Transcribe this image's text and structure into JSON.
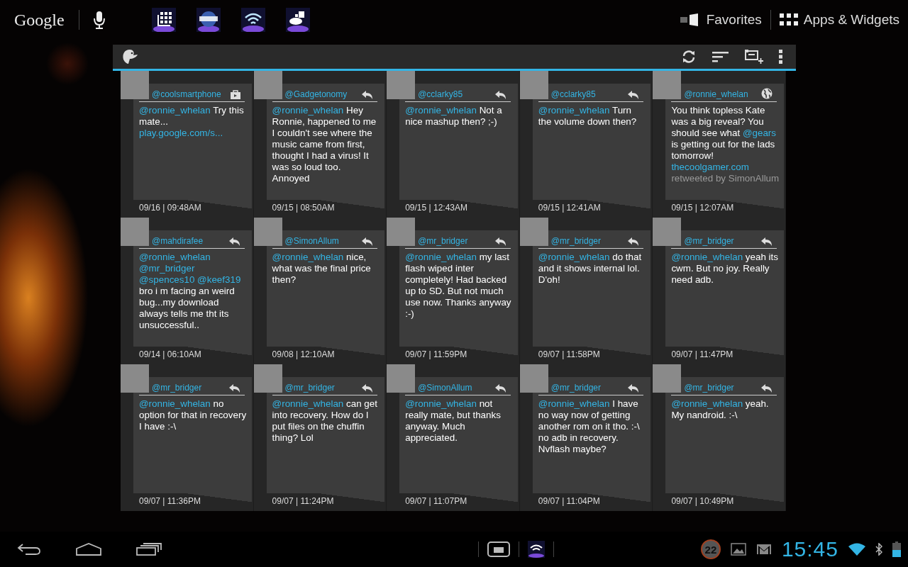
{
  "top_bar": {
    "search_label": "Google",
    "favorites": "Favorites",
    "apps": "Apps & Widgets"
  },
  "tweets": [
    {
      "handle": "@coolsmartphone",
      "kind": "store",
      "parts": [
        {
          "kind": "mention",
          "text": "@ronnie_whelan"
        },
        {
          "kind": "plain",
          "text": "Try this mate..."
        },
        {
          "kind": "link",
          "text": "play.google.com/s..."
        }
      ],
      "time": "09/16 | 09:48AM"
    },
    {
      "handle": "@Gadgetonomy",
      "kind": "reply",
      "parts": [
        {
          "kind": "mention",
          "text": "@ronnie_whelan"
        },
        {
          "kind": "plain",
          "text": "Hey Ronnie, happened to me I couldn't see where the music came from first, thought I had a virus! It was so loud too. Annoyed"
        }
      ],
      "time": "09/15 | 08:50AM"
    },
    {
      "handle": "@cclarky85",
      "kind": "reply",
      "parts": [
        {
          "kind": "mention",
          "text": "@ronnie_whelan"
        },
        {
          "kind": "plain",
          "text": "Not a nice mashup then? ;-)"
        }
      ],
      "time": "09/15 | 12:43AM"
    },
    {
      "handle": "@cclarky85",
      "kind": "reply",
      "parts": [
        {
          "kind": "mention",
          "text": "@ronnie_whelan"
        },
        {
          "kind": "plain",
          "text": "Turn the volume down then?"
        }
      ],
      "time": "09/15 | 12:41AM"
    },
    {
      "handle": "@ronnie_whelan",
      "kind": "globe",
      "parts": [
        {
          "kind": "plain",
          "text": "You think topless Kate was a big reveal? You should see what"
        },
        {
          "kind": "mention",
          "text": "@gears"
        },
        {
          "kind": "plain",
          "text": "is getting out for the lads tomorrow!"
        },
        {
          "kind": "link",
          "text": "thecoolgamer.com"
        },
        {
          "kind": "retweet",
          "text": "retweeted by SimonAllum"
        }
      ],
      "time": "09/15 | 12:07AM"
    },
    {
      "handle": "@mahdirafee",
      "kind": "reply",
      "parts": [
        {
          "kind": "mention",
          "text": "@ronnie_whelan"
        },
        {
          "kind": "mention",
          "text": "@mr_bridger"
        },
        {
          "kind": "mention",
          "text": "@spences10"
        },
        {
          "kind": "mention",
          "text": "@keef319"
        },
        {
          "kind": "plain",
          "text": "bro i m facing an weird bug...my download always tells me tht its unsuccessful.."
        }
      ],
      "time": "09/14 | 06:10AM"
    },
    {
      "handle": "@SimonAllum",
      "kind": "reply",
      "parts": [
        {
          "kind": "mention",
          "text": "@ronnie_whelan"
        },
        {
          "kind": "plain",
          "text": "nice, what was the final price then?"
        }
      ],
      "time": "09/08 | 12:10AM"
    },
    {
      "handle": "@mr_bridger",
      "kind": "reply",
      "parts": [
        {
          "kind": "mention",
          "text": "@ronnie_whelan"
        },
        {
          "kind": "plain",
          "text": "my last flash wiped inter completely! Had backed up to SD. But not much use now. Thanks anyway :-)"
        }
      ],
      "time": "09/07 | 11:59PM"
    },
    {
      "handle": "@mr_bridger",
      "kind": "reply",
      "parts": [
        {
          "kind": "mention",
          "text": "@ronnie_whelan"
        },
        {
          "kind": "plain",
          "text": "do that and it shows internal lol. D'oh!"
        }
      ],
      "time": "09/07 | 11:58PM"
    },
    {
      "handle": "@mr_bridger",
      "kind": "reply",
      "parts": [
        {
          "kind": "mention",
          "text": "@ronnie_whelan"
        },
        {
          "kind": "plain",
          "text": "yeah its cwm. But no joy. Really need adb."
        }
      ],
      "time": "09/07 | 11:47PM"
    },
    {
      "handle": "@mr_bridger",
      "kind": "reply",
      "parts": [
        {
          "kind": "mention",
          "text": "@ronnie_whelan"
        },
        {
          "kind": "plain",
          "text": "no option for that in recovery I have :-\\"
        }
      ],
      "time": "09/07 | 11:36PM"
    },
    {
      "handle": "@mr_bridger",
      "kind": "reply",
      "parts": [
        {
          "kind": "mention",
          "text": "@ronnie_whelan"
        },
        {
          "kind": "plain",
          "text": "can get into recovery. How do I put files on the chuffin thing? Lol"
        }
      ],
      "time": "09/07 | 11:24PM"
    },
    {
      "handle": "@SimonAllum",
      "kind": "reply",
      "parts": [
        {
          "kind": "mention",
          "text": "@ronnie_whelan"
        },
        {
          "kind": "plain",
          "text": "not really mate, but thanks anyway. Much appreciated."
        }
      ],
      "time": "09/07 | 11:07PM"
    },
    {
      "handle": "@mr_bridger",
      "kind": "reply",
      "parts": [
        {
          "kind": "mention",
          "text": "@ronnie_whelan"
        },
        {
          "kind": "plain",
          "text": "I have no way now of getting another rom on it tho. :-\\ no adb in recovery. Nvflash maybe?"
        }
      ],
      "time": "09/07 | 11:04PM"
    },
    {
      "handle": "@mr_bridger",
      "kind": "reply",
      "parts": [
        {
          "kind": "mention",
          "text": "@ronnie_whelan"
        },
        {
          "kind": "plain",
          "text": "yeah. My nandroid. :-\\"
        }
      ],
      "time": "09/07 | 10:49PM"
    }
  ],
  "status_bar": {
    "notification_count": "22",
    "time": "15:45"
  }
}
